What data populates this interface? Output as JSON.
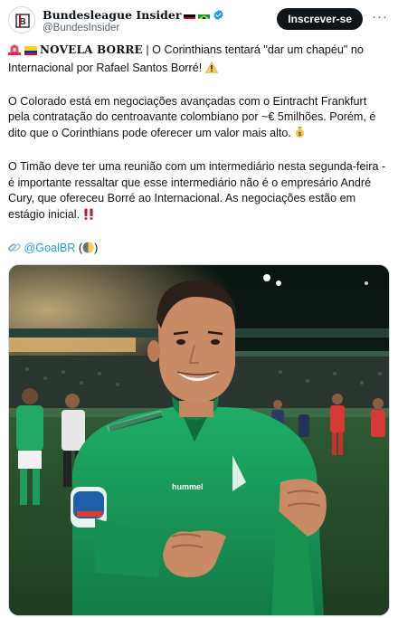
{
  "account": {
    "display_name": "Bundesleague Insider",
    "handle": "@BundesInsider",
    "avatar_text": "B"
  },
  "actions": {
    "subscribe_label": "Inscrever-se",
    "more_label": "···"
  },
  "tweet": {
    "line1_title": "NOVELA BORRE",
    "line1_rest": " | O Corinthians tentará \"dar um chapéu\" no Internacional por Rafael Santos Borré! ",
    "paragraph2": "O Colorado está em negociações avançadas com o Eintracht Frankfurt pela contratação do centroavante colombiano por ~€ 5milhões. Porém, é dito que o Corinthians pode oferecer um valor mais alto. ",
    "paragraph3": "O Timão deve ter uma reunião com um intermediário nesta segunda-feira - é importante ressaltar que esse intermediário não é o empresário André Cury, que ofereceu Borré ao Internacional. As negociações estão em estágio inicial. ",
    "source_mention": "@GoalBR",
    "source_prefix": " ",
    "source_open": " (",
    "source_close": ")"
  },
  "icons": {
    "flags": [
      "germany-flag",
      "brazil-flag"
    ],
    "verified": "verified-badge-icon",
    "warning": "warning-icon",
    "money_bag": "money-bag-icon",
    "double_exclamation": "double-exclamation-icon",
    "link": "link-icon",
    "moon": "moon-icon",
    "siren": "siren-icon",
    "colombia_flag": "colombia-flag"
  },
  "colors": {
    "accent": "#1d9bf0",
    "text": "#0f1419",
    "muted": "#536471",
    "jersey_green": "#1a9c5b"
  }
}
